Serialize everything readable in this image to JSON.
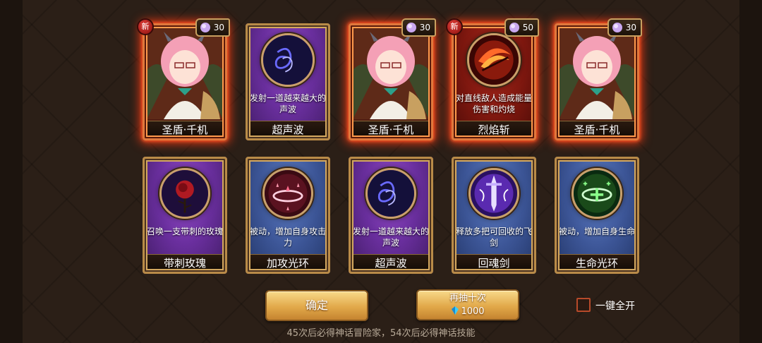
{
  "row1": [
    {
      "kind": "hero",
      "badge_new": "新",
      "cost": "30",
      "name": "圣盾·千机",
      "glow": true
    },
    {
      "kind": "skill",
      "theme": "purple",
      "icon": "sonic-wave-icon",
      "desc": "发射一道越来越大的声波",
      "name": "超声波"
    },
    {
      "kind": "hero",
      "cost": "30",
      "name": "圣盾·千机",
      "glow": true
    },
    {
      "kind": "skill",
      "theme": "red",
      "icon": "flame-slash-icon",
      "badge_new": "新",
      "cost": "50",
      "desc": "对直线敌人造成能量伤害和灼烧",
      "name": "烈焰斩",
      "glow": true
    },
    {
      "kind": "hero",
      "cost": "30",
      "name": "圣盾·千机",
      "glow": true
    }
  ],
  "row2": [
    {
      "theme": "purple",
      "icon": "thorn-rose-icon",
      "desc": "召唤一支带刺的玫瑰",
      "name": "带刺玫瑰"
    },
    {
      "theme": "blue",
      "icon": "attack-halo-icon",
      "desc": "被动，增加自身攻击力",
      "name": "加攻光环"
    },
    {
      "theme": "purple",
      "icon": "sonic-wave-icon",
      "desc": "发射一道越来越大的声波",
      "name": "超声波"
    },
    {
      "theme": "blue",
      "icon": "flying-sword-icon",
      "desc": "释放多把可回收的飞剑",
      "name": "回魂剑"
    },
    {
      "theme": "blue",
      "icon": "life-halo-icon",
      "desc": "被动，增加自身生命",
      "name": "生命光环"
    }
  ],
  "buttons": {
    "confirm": "确定",
    "draw_again": "再抽十次",
    "draw_cost": "1000"
  },
  "one_key_open": "一键全开",
  "footer": "45次后必得神话冒险家，54次后必得神话技能",
  "colors": {
    "glow": "#ff3c14",
    "frame_gold": "#b98b48",
    "purple": "#6a2f9e",
    "blue": "#3c5596",
    "red": "#7a160e"
  }
}
